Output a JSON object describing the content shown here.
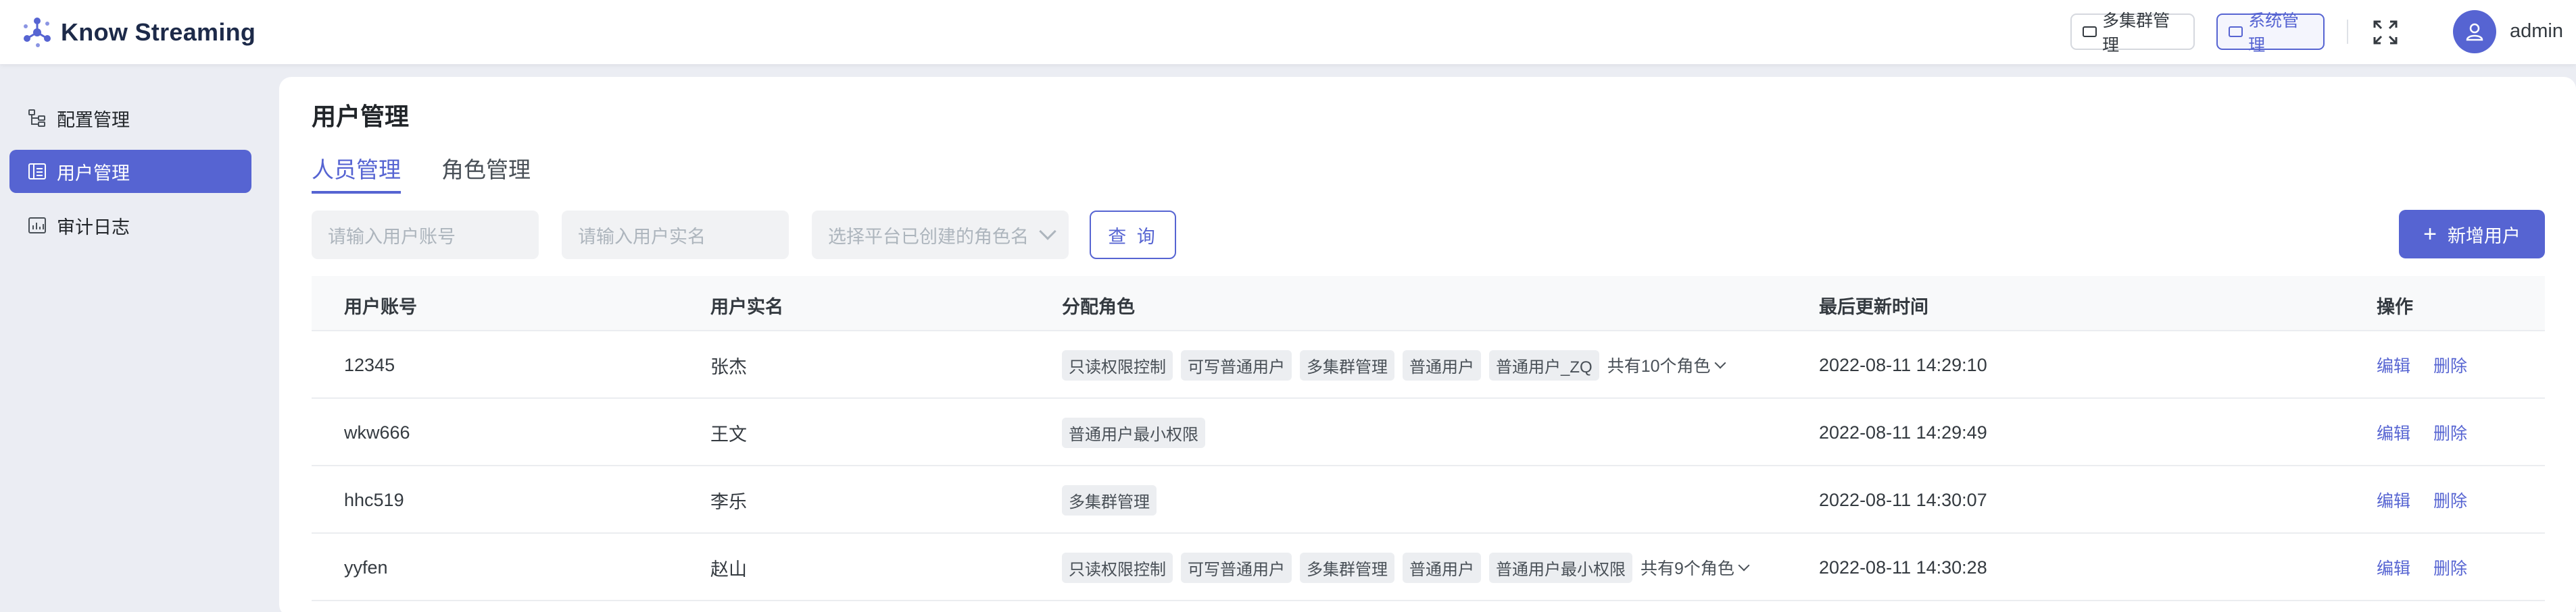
{
  "app": {
    "logo_text": "Know Streaming"
  },
  "header": {
    "multi_cluster_label": "多集群管理",
    "system_label": "系统管理",
    "user_name": "admin"
  },
  "sidebar": {
    "items": [
      {
        "label": "配置管理",
        "icon": "config-tree-icon",
        "active": false
      },
      {
        "label": "用户管理",
        "icon": "user-list-icon",
        "active": true
      },
      {
        "label": "审计日志",
        "icon": "audit-chart-icon",
        "active": false
      }
    ]
  },
  "main": {
    "title": "用户管理",
    "tabs": [
      {
        "label": "人员管理",
        "active": true
      },
      {
        "label": "角色管理",
        "active": false
      }
    ],
    "filters": {
      "account_placeholder": "请输入用户账号",
      "realname_placeholder": "请输入用户实名",
      "role_placeholder": "选择平台已创建的角色名"
    },
    "query_label": "查 询",
    "add_user_label": "新增用户"
  },
  "table": {
    "columns": [
      "用户账号",
      "用户实名",
      "分配角色",
      "最后更新时间",
      "操作"
    ],
    "actions": {
      "edit": "编辑",
      "delete": "删除"
    },
    "rows": [
      {
        "account": "12345",
        "name": "张杰",
        "roles": [
          "只读权限控制",
          "可写普通用户",
          "多集群管理",
          "普通用户",
          "普通用户_ZQ"
        ],
        "more": "共有10个角色",
        "updated": "2022-08-11 14:29:10"
      },
      {
        "account": "wkw666",
        "name": "王文",
        "roles": [
          "普通用户最小权限"
        ],
        "more": "",
        "updated": "2022-08-11 14:29:49"
      },
      {
        "account": "hhc519",
        "name": "李乐",
        "roles": [
          "多集群管理"
        ],
        "more": "",
        "updated": "2022-08-11 14:30:07"
      },
      {
        "account": "yyfen",
        "name": "赵山",
        "roles": [
          "只读权限控制",
          "可写普通用户",
          "多集群管理",
          "普通用户",
          "普通用户最小权限"
        ],
        "more": "共有9个角色",
        "updated": "2022-08-11 14:30:28"
      }
    ]
  },
  "colors": {
    "accent": "#5664d2",
    "background": "#ebedf3"
  }
}
